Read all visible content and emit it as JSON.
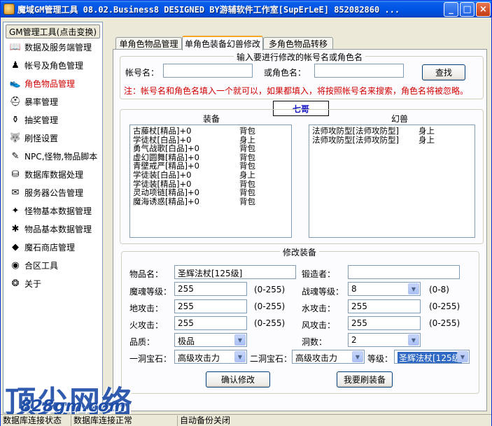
{
  "window": {
    "title": "魔域GM管理工具 08.02.Business8 DESIGNED BY游辅软件工作室[SupErLeE] 852082860 ...",
    "minimize": "_",
    "maximize": "□",
    "close": "×"
  },
  "sidebar": {
    "header": "GM管理工具(点击变换)",
    "items": [
      {
        "label": "数据及服务端管理",
        "icon": "book-icon",
        "glyph": "📖"
      },
      {
        "label": "帐号及角色管理",
        "icon": "character-icon",
        "glyph": "♟"
      },
      {
        "label": "角色物品管理",
        "icon": "shoe-icon",
        "glyph": "👟",
        "active": true
      },
      {
        "label": "暴率管理",
        "icon": "helmet-icon",
        "glyph": "⛑"
      },
      {
        "label": "抽奖管理",
        "icon": "pot-icon",
        "glyph": "⚱"
      },
      {
        "label": "刷怪设置",
        "icon": "wolf-icon",
        "glyph": "🐺"
      },
      {
        "label": "NPC,怪物,物品脚本",
        "icon": "script-icon",
        "glyph": "✎"
      },
      {
        "label": "数据库数据处理",
        "icon": "database-icon",
        "glyph": "⛁"
      },
      {
        "label": "服务器公告管理",
        "icon": "announce-icon",
        "glyph": "✉"
      },
      {
        "label": "怪物基本数据管理",
        "icon": "monster-icon",
        "glyph": "✦"
      },
      {
        "label": "物品基本数据管理",
        "icon": "spider-icon",
        "glyph": "✱"
      },
      {
        "label": "魔石商店管理",
        "icon": "shop-icon",
        "glyph": "◆"
      },
      {
        "label": "合区工具",
        "icon": "merge-icon",
        "glyph": "◉"
      },
      {
        "label": "关于",
        "icon": "about-icon",
        "glyph": "❂"
      }
    ]
  },
  "tabs": [
    {
      "label": "单角色物品管理"
    },
    {
      "label": "单角色装备幻兽修改",
      "active": true
    },
    {
      "label": "多角色物品转移"
    }
  ],
  "search": {
    "legend": "输入要进行修改的帐号名或角色名",
    "account_label": "帐号名：",
    "account_value": "",
    "role_label": "或角色名：",
    "role_value": "",
    "search_button": "查找",
    "note": "注：帐号名和角色名填入一个就可以，如果都填入，将按照帐号名来搜索，角色名将被忽略。"
  },
  "character_name": "七哥",
  "equipment": {
    "legend": "装备",
    "rows": [
      {
        "name": "古藤杖[精品]+0",
        "loc": "背包"
      },
      {
        "name": "学徒杖[白品]+0",
        "loc": "身上"
      },
      {
        "name": "勇气战歌[白品]+0",
        "loc": "背包"
      },
      {
        "name": "虚幻圆舞[精品]+0",
        "loc": "背包"
      },
      {
        "name": "青壁戒严[精品]+0",
        "loc": "背包"
      },
      {
        "name": "学徒装[白品]+0",
        "loc": "身上"
      },
      {
        "name": "学徒装[精品]+0",
        "loc": "背包"
      },
      {
        "name": "灵动项链[精品]+0",
        "loc": "背包"
      },
      {
        "name": "魔海诱惑[精品]+0",
        "loc": "背包"
      }
    ]
  },
  "pets": {
    "legend": "幻兽",
    "rows": [
      {
        "name": "法师攻防型[法师攻防型]",
        "loc": "身上"
      },
      {
        "name": "法师攻防型[法师攻防型]",
        "loc": "身上"
      }
    ]
  },
  "edit": {
    "legend": "修改装备",
    "item_name_label": "物品名：",
    "item_name_value": "圣辉法杖[125级]",
    "forger_label": "锻造者：",
    "forger_value": "",
    "soul_label": "魔魂等级：",
    "soul_value": "255",
    "soul_range": "(0-255)",
    "battle_soul_label": "战魂等级：",
    "battle_soul_value": "8",
    "battle_soul_range": "(0-8)",
    "earth_label": "地攻击：",
    "earth_value": "255",
    "earth_range": "(0-255)",
    "water_label": "水攻击：",
    "water_value": "255",
    "water_range": "(0-255)",
    "fire_label": "火攻击：",
    "fire_value": "255",
    "fire_range": "(0-255)",
    "wind_label": "风攻击：",
    "wind_value": "255",
    "wind_range": "(0-255)",
    "quality_label": "品质：",
    "quality_value": "极品",
    "holes_label": "洞数：",
    "holes_value": "2",
    "gem1_label": "一洞宝石：",
    "gem1_value": "高级攻击力",
    "gem2_label": "二洞宝石：",
    "gem2_value": "高级攻击力",
    "level_label": "等级：",
    "level_value": "圣辉法杖[125级",
    "confirm_button": "确认修改",
    "refresh_button": "我要刷装备"
  },
  "watermark": {
    "line1": "顶尖网络",
    "line2": "828gm.com"
  },
  "statusbar": {
    "cell1": "数据库连接状态",
    "cell2": "数据库连接正常",
    "cell3": "自动备份关闭"
  }
}
